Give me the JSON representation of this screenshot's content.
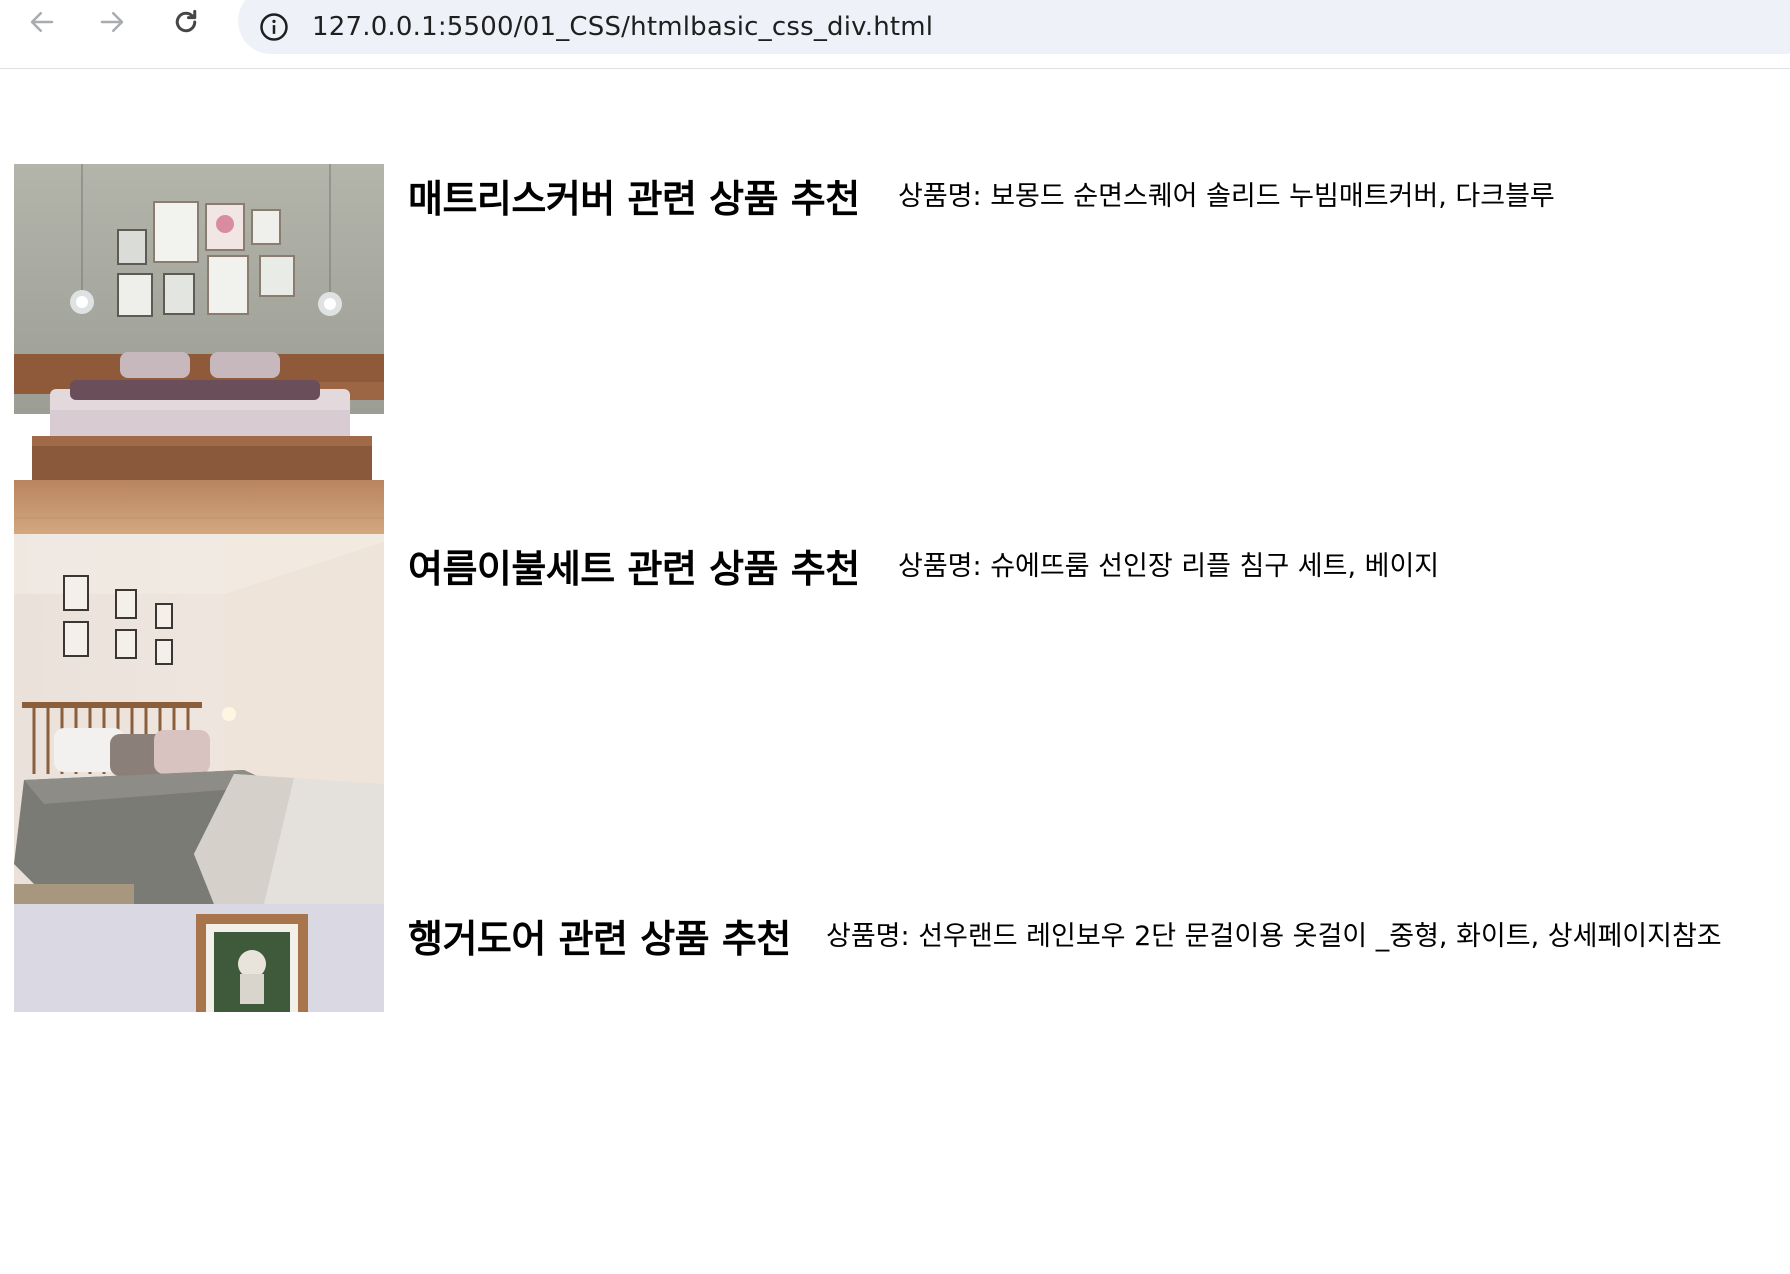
{
  "browser": {
    "url": "127.0.0.1:5500/01_CSS/htmlbasic_css_div.html"
  },
  "products": [
    {
      "title": "매트리스커버 관련 상품 추천",
      "name": "상품명: 보몽드 순면스퀘어 솔리드 누빔매트커버, 다크블루",
      "image": "bedroom-wooden-bed-photo"
    },
    {
      "title": "여름이불세트 관련 상품 추천",
      "name": "상품명: 슈에뜨룸 선인장 리플 침구 세트, 베이지",
      "image": "bedroom-gray-bedding-photo"
    },
    {
      "title": "행거도어 관련 상품 추천",
      "name": "상품명: 선우랜드 레인보우 2단 문걸이용 옷걸이 _중형, 화이트, 상세페이지참조",
      "image": "framed-picture-photo"
    }
  ]
}
